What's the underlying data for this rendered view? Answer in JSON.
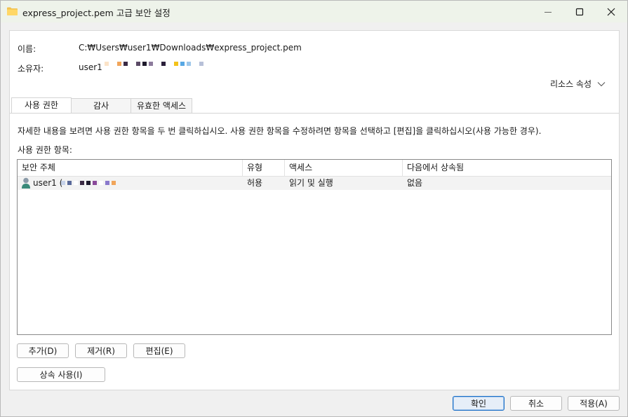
{
  "window": {
    "title": "express_project.pem 고급 보안 설정"
  },
  "info": {
    "name_label": "이름:",
    "name_value": "C:₩Users₩user1₩Downloads₩express_project.pem",
    "owner_label": "소유자:",
    "owner_value": "user1",
    "resource_attributes": "리소스 속성"
  },
  "tabs": [
    {
      "label": "사용 권한"
    },
    {
      "label": "감사"
    },
    {
      "label": "유효한 액세스"
    }
  ],
  "instructions": "자세한 내용을 보려면 사용 권한 항목을 두 번 클릭하십시오. 사용 권한 항목을 수정하려면 항목을 선택하고 [편집]을 클릭하십시오(사용 가능한 경우).",
  "entries_label": "사용 권한 항목:",
  "table": {
    "headers": [
      "보안 주체",
      "유형",
      "액세스",
      "다음에서 상속됨"
    ],
    "rows": [
      {
        "principal": "user1 (",
        "type": "허용",
        "access": "읽기 및 실행",
        "inherited": "없음"
      }
    ]
  },
  "buttons": {
    "add": "추가(D)",
    "remove": "제거(R)",
    "edit": "편집(E)",
    "inherit": "상속 사용(I)",
    "ok": "확인",
    "cancel": "취소",
    "apply": "적용(A)"
  },
  "colors": {
    "titlebar": "#eef3ea",
    "accent": "#1a6fc7"
  }
}
